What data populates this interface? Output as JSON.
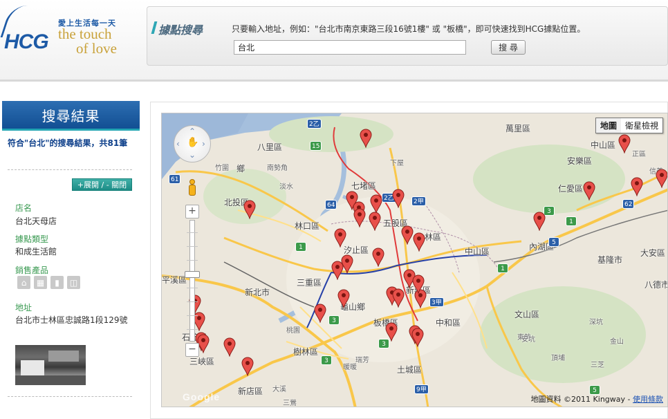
{
  "brand": {
    "logo_text": "HCG",
    "tagline_cn": "愛上生活每一天",
    "tagline_en_1": "the touch",
    "tagline_en_2": "of love"
  },
  "search": {
    "title": "據點搜尋",
    "hint": "只要輸入地址，例如：\"台北市南京東路三段16號1樓\" 或 \"板橋\"，即可快速找到HCG據點位置。",
    "value": "台北",
    "button_label": "搜 尋"
  },
  "sidebar": {
    "header": "搜尋結果",
    "summary": "符合\"台北\"的搜尋結果，共81筆",
    "toggle_label": "+展開 / - 關閉",
    "store_name_label": "店名",
    "store_name": "台北天母店",
    "store_type_label": "據點類型",
    "store_type": "和成生活館",
    "products_label": "銷售產品",
    "product_icons": [
      "sink-icon",
      "tile-icon",
      "door-icon",
      "toilet-icon"
    ],
    "address_label": "地址",
    "address": "台北市士林區忠誠路1段129號"
  },
  "map": {
    "type_map": "地圖",
    "type_satellite": "衛星檢視",
    "attribution": "地圖資料 ©2011 Kingway -",
    "terms": "使用條款",
    "google": "Google",
    "labels": [
      "萬里區",
      "八里區",
      "中山區",
      "安樂區",
      "信義",
      "正區",
      "仁愛區",
      "七堵區",
      "北投區",
      "林口區",
      "五股區",
      "士林區",
      "中山區",
      "內湖區",
      "汐止區",
      "三重區",
      "新莊區",
      "大安區",
      "基隆市",
      "新北市",
      "龜山鄉",
      "板橋區",
      "中和區",
      "文山區",
      "石碇區",
      "桃園",
      "樹林區",
      "土城區",
      "新店區",
      "三峽區",
      "八德市",
      "平溪區",
      "鄉",
      "南勢角",
      "下屋",
      "竹圍",
      "淡水",
      "三芝",
      "金山",
      "東勢",
      "瑞芳",
      "暖暖",
      "深坑",
      "頂埔",
      "大溪",
      "三鶯",
      "安坑",
      "雙溪"
    ],
    "route_badges": [
      "2乙",
      "15",
      "2乙",
      "64",
      "2甲",
      "61",
      "62",
      "5",
      "1",
      "3",
      "1",
      "3甲",
      "3",
      "3",
      "9甲",
      "5",
      "1",
      "3"
    ]
  }
}
